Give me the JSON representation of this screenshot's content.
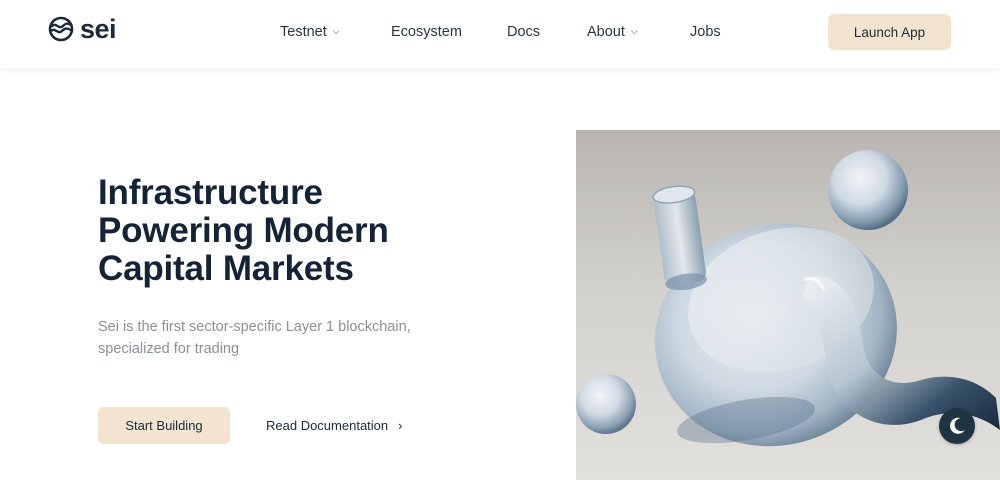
{
  "header": {
    "brand": "sei",
    "nav": [
      {
        "label": "Testnet",
        "has_dropdown": true
      },
      {
        "label": "Ecosystem",
        "has_dropdown": false
      },
      {
        "label": "Docs",
        "has_dropdown": false
      },
      {
        "label": "About",
        "has_dropdown": true
      },
      {
        "label": "Jobs",
        "has_dropdown": false
      }
    ],
    "launch_label": "Launch App"
  },
  "hero": {
    "title_lines": [
      "Infrastructure",
      "Powering Modern",
      "Capital Markets"
    ],
    "subtitle_lines": [
      "Sei is the first sector-specific Layer 1 blockchain,",
      "specialized for trading"
    ],
    "primary_label": "Start Building",
    "secondary_label": "Read Documentation",
    "secondary_icon": "chevron-right-icon"
  },
  "theme_toggle": {
    "icon": "moon-icon"
  },
  "colors": {
    "accent": "#f2e4cf",
    "text_dark": "#142436",
    "text_muted": "#8a9099",
    "toggle_bg": "#1f3340"
  }
}
